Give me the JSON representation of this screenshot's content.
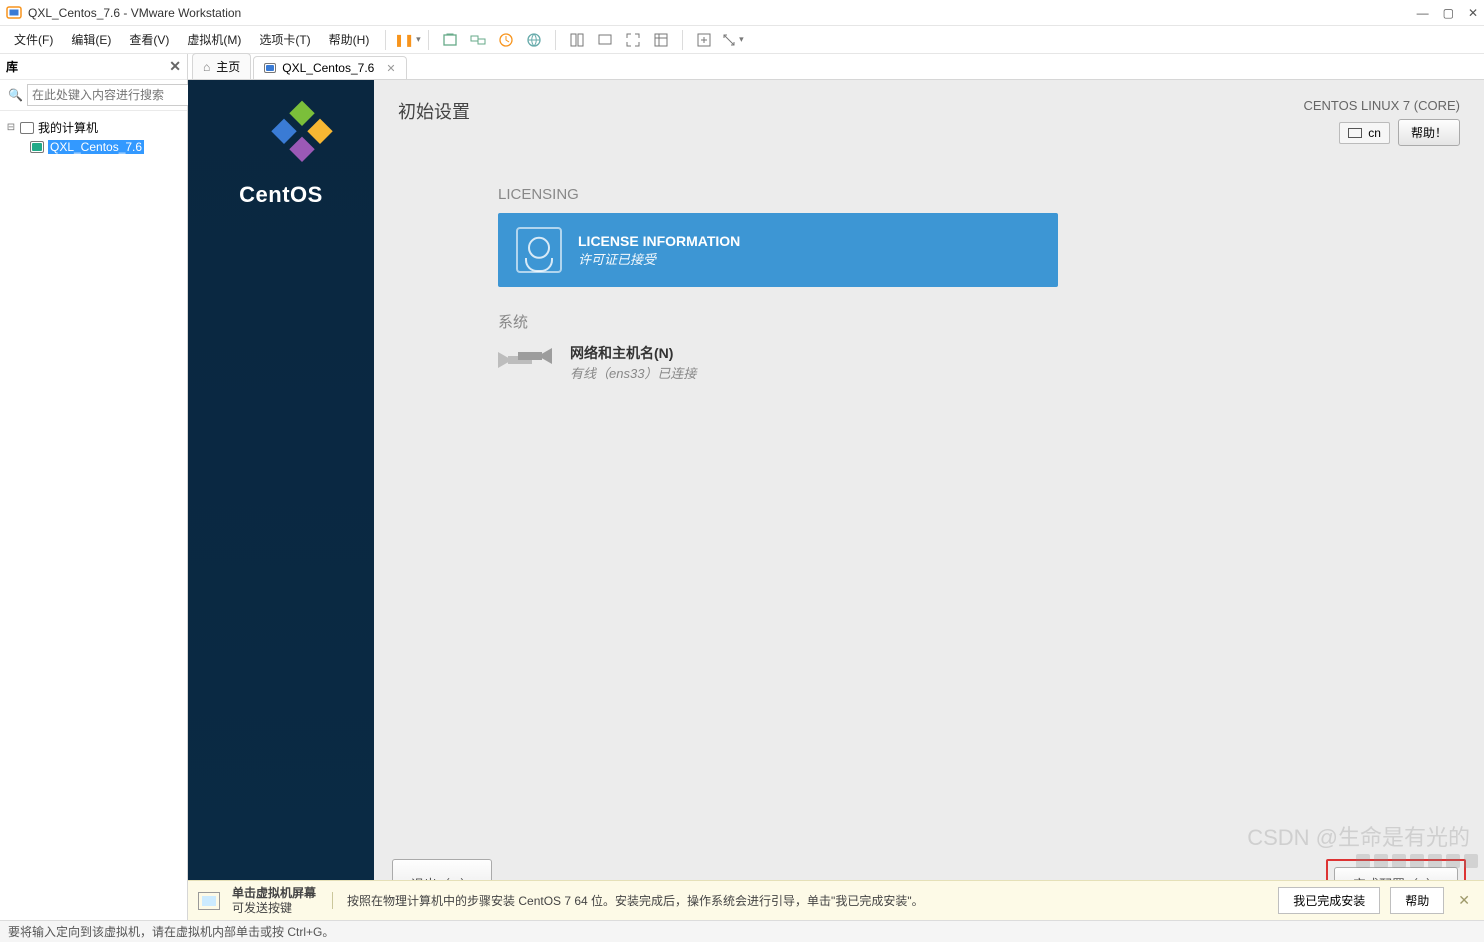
{
  "window": {
    "title": "QXL_Centos_7.6 - VMware Workstation"
  },
  "menus": {
    "file": "文件(F)",
    "edit": "编辑(E)",
    "view": "查看(V)",
    "vm": "虚拟机(M)",
    "tabs": "选项卡(T)",
    "help": "帮助(H)"
  },
  "sidebar": {
    "title": "库",
    "search_placeholder": "在此处键入内容进行搜索",
    "root": "我的计算机",
    "item": "QXL_Centos_7.6"
  },
  "tabs": {
    "home": "主页",
    "vm": "QXL_Centos_7.6"
  },
  "initial": {
    "heading": "初始设置",
    "os": "CENTOS LINUX 7 (CORE)",
    "keyboard": "cn",
    "help": "帮助！",
    "licensing_section": "LICENSING",
    "license_title": "LICENSE INFORMATION",
    "license_sub": "许可证已接受",
    "system_section": "系统",
    "network_title": "网络和主机名(N)",
    "network_sub": "有线（ens33）已连接",
    "quit": "退出（Q）",
    "finish": "完成配置（F）",
    "centos": "CentOS"
  },
  "hint": {
    "line1": "单击虚拟机屏幕",
    "line2": "可发送按键",
    "desc": "按照在物理计算机中的步骤安装 CentOS 7 64 位。安装完成后，操作系统会进行引导，单击\"我已完成安装\"。",
    "done": "我已完成安装",
    "help": "帮助"
  },
  "status": {
    "text": "要将输入定向到该虚拟机，请在虚拟机内部单击或按 Ctrl+G。"
  },
  "watermark": "CSDN @生命是有光的"
}
